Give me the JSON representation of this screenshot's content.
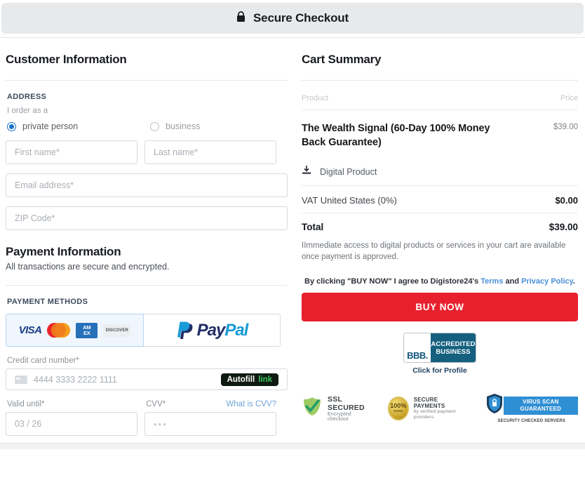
{
  "header": {
    "title": "Secure Checkout",
    "lock_icon": "lock-icon"
  },
  "customer": {
    "title": "Customer Information",
    "address_label": "ADDRESS",
    "order_as_label": "I order as a",
    "radios": [
      {
        "label": "private person",
        "selected": true
      },
      {
        "label": "business",
        "selected": false
      }
    ],
    "fields": [
      {
        "name": "first-name",
        "placeholder": "First name*",
        "value": ""
      },
      {
        "name": "last-name",
        "placeholder": "Last name*",
        "value": ""
      },
      {
        "name": "email",
        "placeholder": "Email address*",
        "value": ""
      },
      {
        "name": "zip",
        "placeholder": "ZIP Code*",
        "value": ""
      }
    ]
  },
  "payment": {
    "title": "Payment Information",
    "subtitle": "All transactions are secure and encrypted.",
    "methods_label": "PAYMENT METHODS",
    "methods": [
      {
        "name": "credit-card",
        "selected": true,
        "brands": [
          "VISA",
          "Mastercard",
          "AMEX",
          "DISCOVER"
        ]
      },
      {
        "name": "paypal",
        "selected": false,
        "label_pay": "Pay",
        "label_pal": "Pal"
      }
    ],
    "card_number_label": "Credit card number*",
    "card_number_placeholder": "4444 3333 2222 1111",
    "card_number_value": "",
    "autofill": {
      "label": "Autofill",
      "suffix": "link"
    },
    "valid_until_label": "Valid until*",
    "valid_until_placeholder": "03 / 26",
    "valid_until_value": "",
    "cvv_label": "CVV*",
    "cvv_placeholder": "•••",
    "cvv_value": "",
    "cvv_help": "What is CVV?",
    "brand_visa": "VISA",
    "brand_amex_line1": "AM",
    "brand_amex_line2": "EX",
    "brand_discover": "DISCOVER"
  },
  "cart": {
    "title": "Cart Summary",
    "col_product": "Product",
    "col_price": "Price",
    "items": [
      {
        "name": "The Wealth Signal (60-Day 100% Money Back Guarantee)",
        "price": "$39.00"
      }
    ],
    "delivery_icon": "download-icon",
    "delivery_type": "Digital Product",
    "vat_label": "VAT United States (0%)",
    "vat_value": "$0.00",
    "total_label": "Total",
    "total_value": "$39.00",
    "note": "IImmediate access to digital products or services in your cart are available once payment is approved.",
    "terms_prefix": "By clicking \"BUY NOW\" I agree to Digistore24's ",
    "terms_link": "Terms",
    "terms_middle": " and ",
    "privacy_link": "Privacy Policy",
    "terms_suffix": ".",
    "buy_button": "BUY NOW",
    "accent_color": "#e8202e",
    "link_color": "#4a90d9"
  },
  "badges": {
    "bbb": {
      "letters": "BBB.",
      "line1": "ACCREDITED",
      "line2": "BUSINESS",
      "profile_label": "Click for Profile"
    },
    "trust": [
      {
        "icon": "ssl-check-icon",
        "title": "SSL SECURED",
        "subtitle": "Encrypted checkout"
      },
      {
        "icon": "gold-seal-icon",
        "seal_pct": "100%",
        "seal_safe": "SAFE",
        "title": "SECURE PAYMENTS",
        "subtitle": "by verified payment providers"
      },
      {
        "icon": "shield-lock-icon",
        "title": "VIRUS SCAN GUARANTEED",
        "subtitle": "SECURITY CHECKED SERVERS"
      }
    ]
  }
}
